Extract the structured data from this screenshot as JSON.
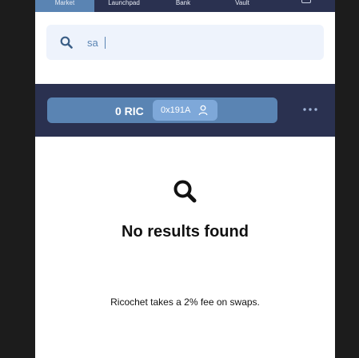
{
  "nav": {
    "tabs": [
      {
        "label": "Market",
        "active": true
      },
      {
        "label": "Launchpad",
        "active": false
      },
      {
        "label": "Bank",
        "active": false
      },
      {
        "label": "Vault",
        "active": false
      }
    ],
    "extra_icon": "wallet-icon"
  },
  "search": {
    "value": "sa",
    "icon": "search-icon"
  },
  "wallet": {
    "balance": "0 RIC",
    "address": "0x191A",
    "address_icon": "user-icon",
    "more_icon": "more-horizontal-icon"
  },
  "results": {
    "icon": "search-icon",
    "empty_message": "No results found",
    "fee_note": "Ricochet takes a 2% fee on swaps."
  },
  "colors": {
    "nav_bg": "#2a3150",
    "accent": "#5a84b3",
    "chip": "#7ea8d9",
    "search_bg": "#eef3fc",
    "page_bg": "#1c1c1c"
  }
}
